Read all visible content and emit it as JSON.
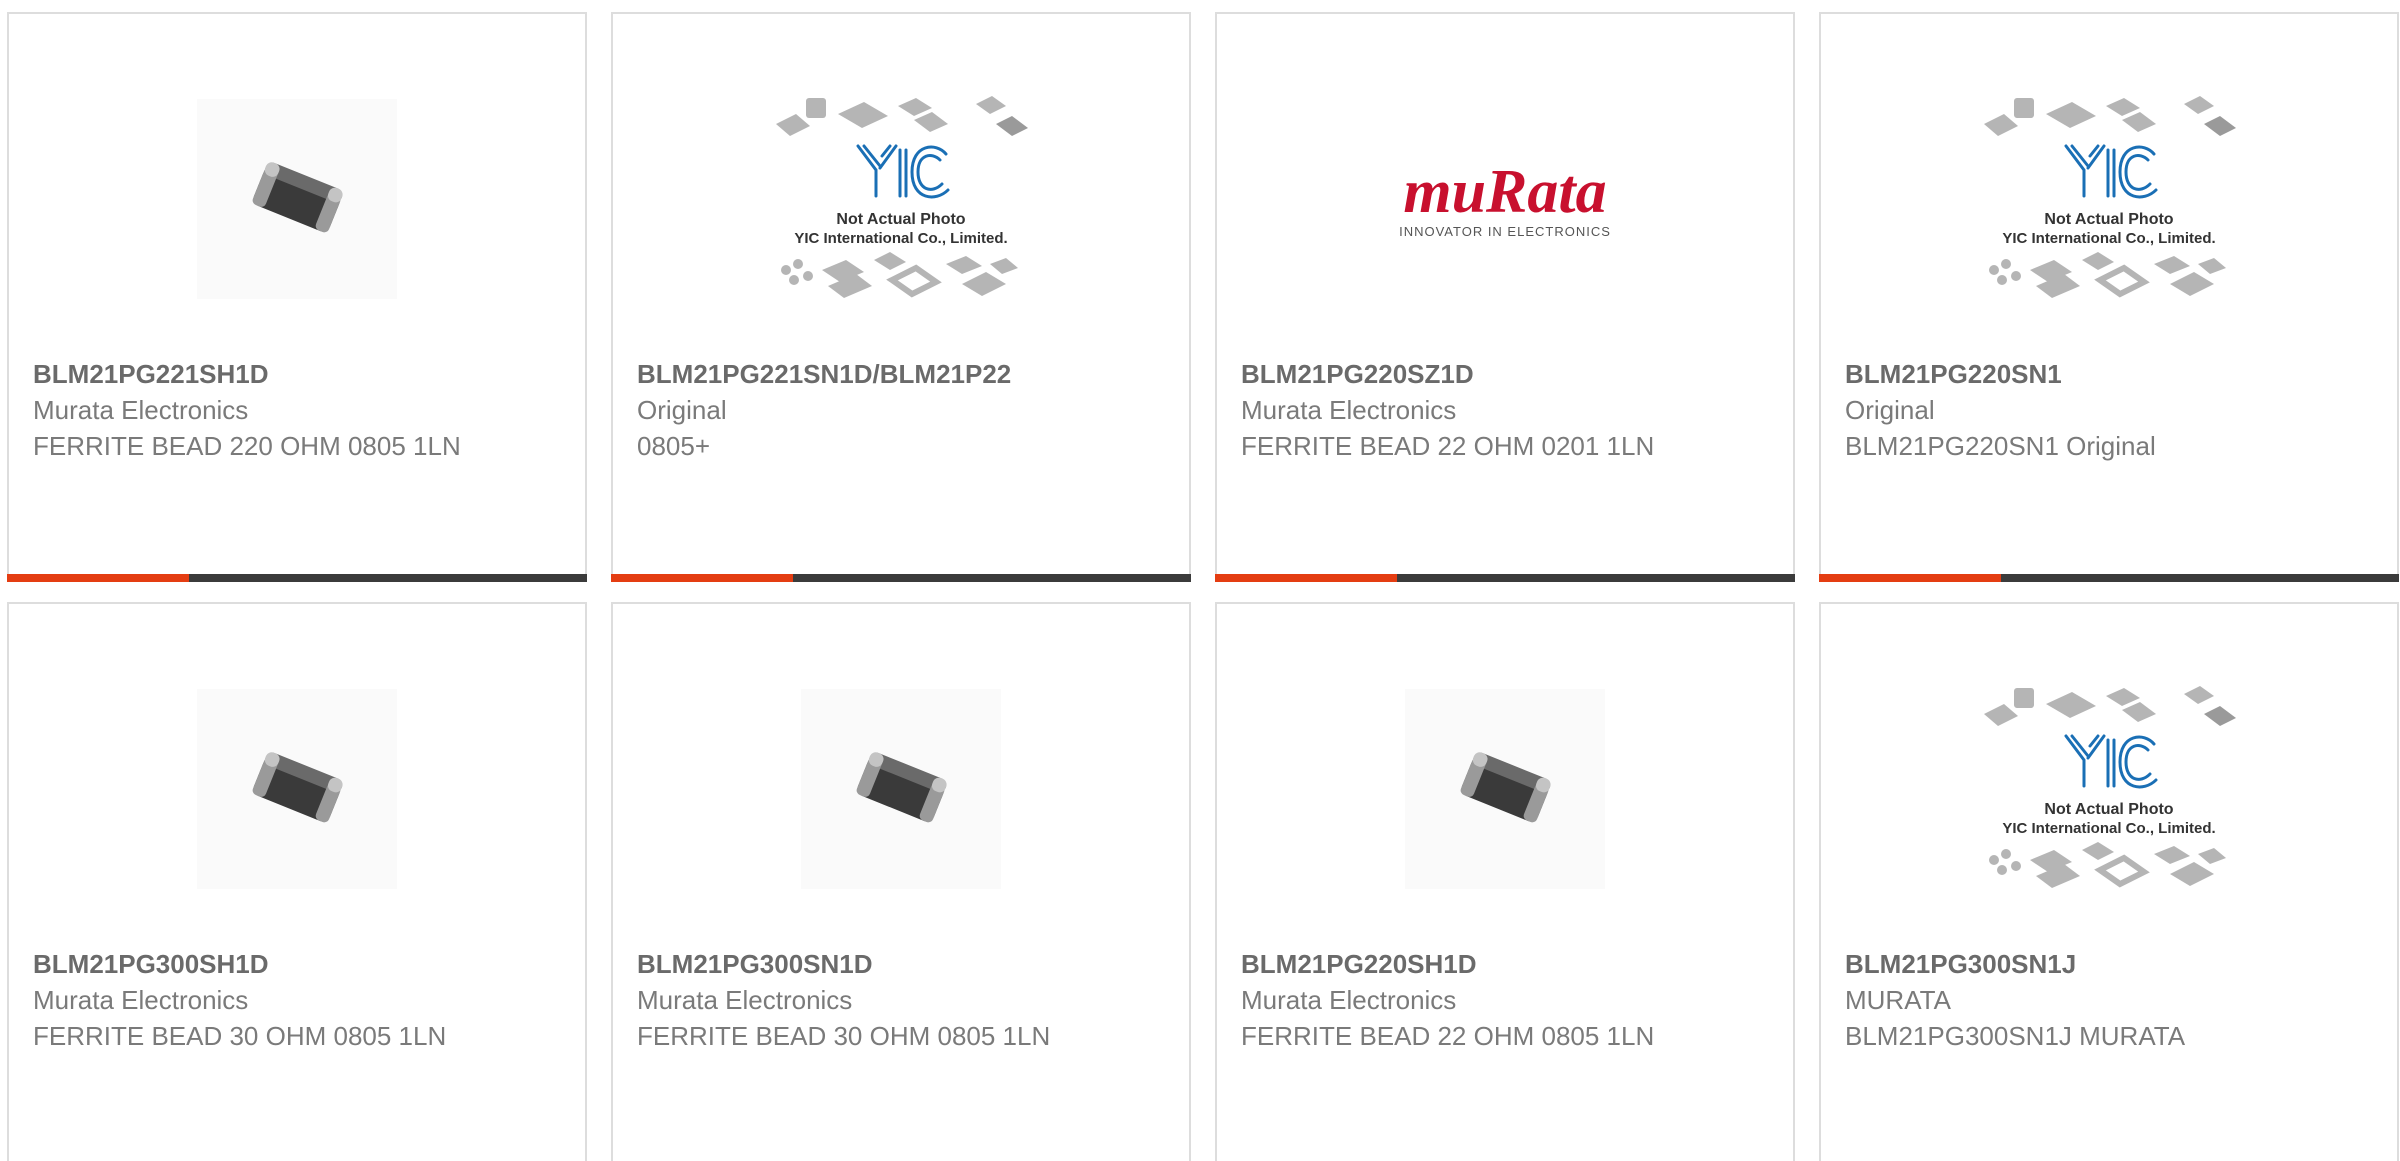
{
  "colors": {
    "accent": "#e43d12",
    "bar": "#3b3b3b",
    "text": "#6a6a6a",
    "murata_red": "#c8102e",
    "yic_blue": "#1a6fb5"
  },
  "placeholder": {
    "line1": "Not Actual Photo",
    "line2": "YIC International Co., Limited."
  },
  "murata_logo": {
    "word": "muRata",
    "tagline": "INNOVATOR IN ELECTRONICS"
  },
  "products": [
    {
      "part": "BLM21PG221SH1D",
      "mfr": "Murata Electronics",
      "desc": "FERRITE BEAD 220 OHM 0805 1LN",
      "image": "chip-bead-photo"
    },
    {
      "part": "BLM21PG221SN1D/BLM21P22",
      "mfr": "Original",
      "desc": "0805+",
      "image": "yic-placeholder"
    },
    {
      "part": "BLM21PG220SZ1D",
      "mfr": "Murata Electronics",
      "desc": "FERRITE BEAD 22 OHM 0201 1LN",
      "image": "murata-logo"
    },
    {
      "part": "BLM21PG220SN1",
      "mfr": "Original",
      "desc": "BLM21PG220SN1 Original",
      "image": "yic-placeholder"
    },
    {
      "part": "BLM21PG300SH1D",
      "mfr": "Murata Electronics",
      "desc": "FERRITE BEAD 30 OHM 0805 1LN",
      "image": "chip-bead-photo"
    },
    {
      "part": "BLM21PG300SN1D",
      "mfr": "Murata Electronics",
      "desc": "FERRITE BEAD 30 OHM 0805 1LN",
      "image": "chip-bead-photo"
    },
    {
      "part": "BLM21PG220SH1D",
      "mfr": "Murata Electronics",
      "desc": "FERRITE BEAD 22 OHM 0805 1LN",
      "image": "chip-bead-photo"
    },
    {
      "part": "BLM21PG300SN1J",
      "mfr": "MURATA",
      "desc": "BLM21PG300SN1J MURATA",
      "image": "yic-placeholder"
    }
  ]
}
